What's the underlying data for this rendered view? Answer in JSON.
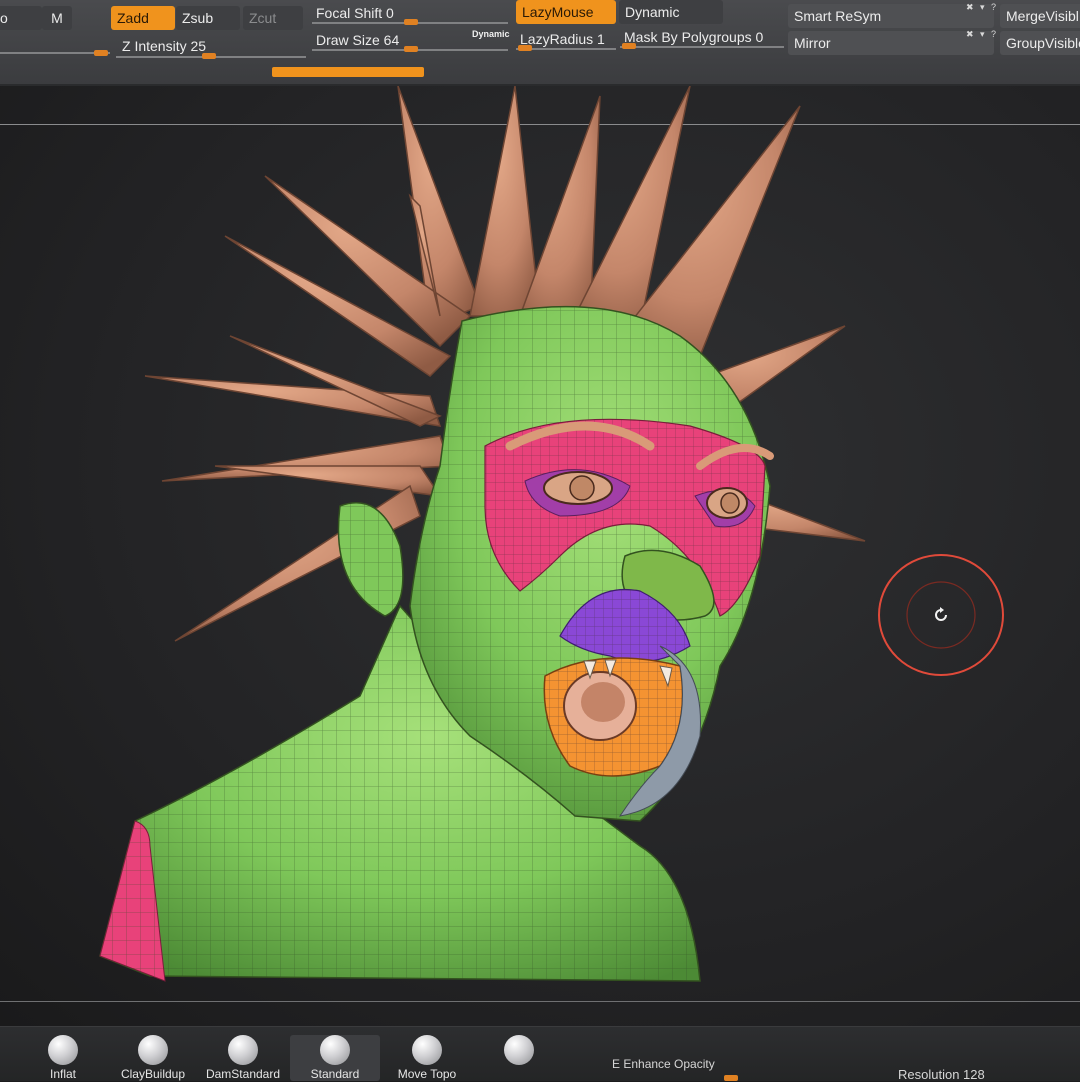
{
  "toolbar": {
    "mode_cut": "o",
    "m_button": "M",
    "zadd": "Zadd",
    "zsub": "Zsub",
    "zcut": "Zcut",
    "focal_shift": "Focal Shift 0",
    "z_intensity": "Z Intensity 25",
    "draw_size": "Draw Size 64",
    "dynamic_small": "Dynamic",
    "lazy_mouse": "LazyMouse",
    "lazy_radius": "LazyRadius 1",
    "dynamic": "Dynamic",
    "mask_by_polygroups": "Mask By Polygroups 0",
    "smart_resym": "Smart ReSym",
    "mirror": "Mirror",
    "merge_visible": "MergeVisibl",
    "group_visible": "GroupVisible"
  },
  "shelf": {
    "brushes": [
      "Inflat",
      "ClayBuildup",
      "DamStandard",
      "Standard",
      "Move Topo",
      ""
    ],
    "enhance_opacity": "E Enhance Opacity",
    "resolution": "Resolution 128"
  },
  "colors": {
    "accent": "#f0931d",
    "skin": "#c98a6a",
    "polygroup_green": "#7fc85a",
    "polygroup_pink": "#e8427a",
    "polygroup_purple": "#8a48d6",
    "polygroup_orange": "#f49332",
    "gizmo_ring": "#e04a3a"
  },
  "icons": {
    "rotate": "rotate-icon"
  }
}
